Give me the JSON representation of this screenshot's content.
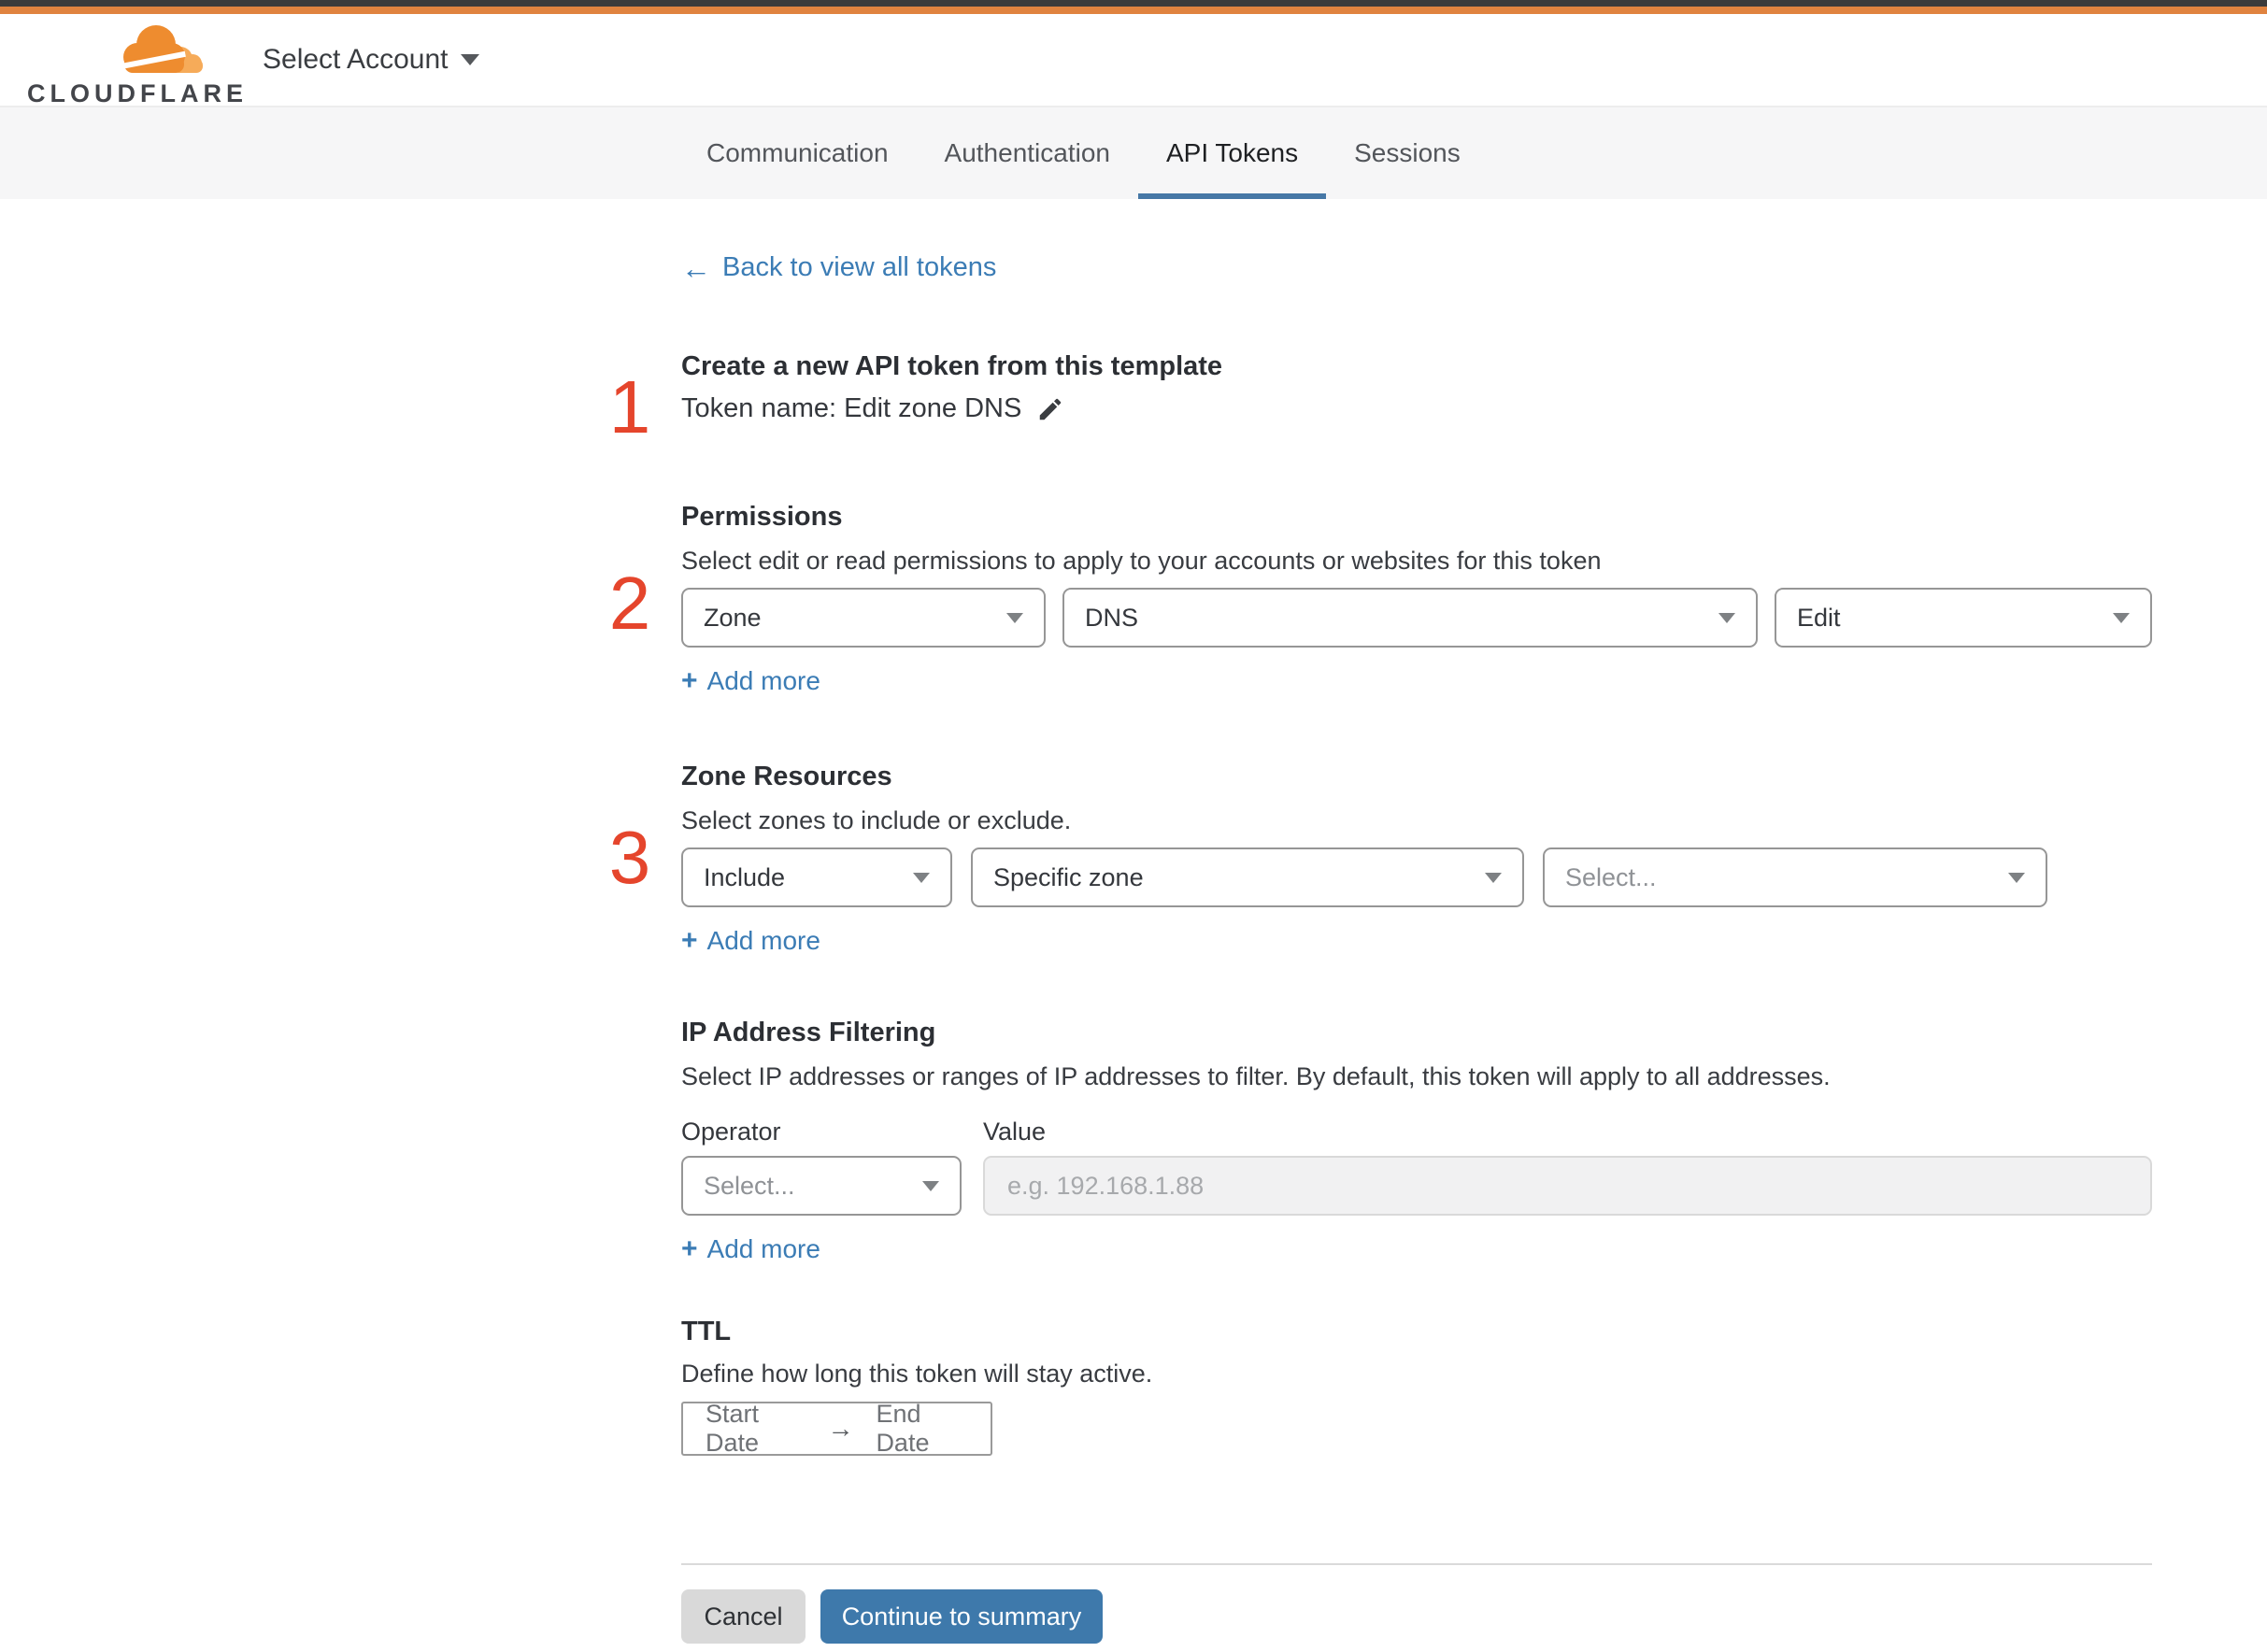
{
  "colors": {
    "topbar_dark": "#3b3b3b",
    "topbar_orange": "#e0833f",
    "brand_orange": "#ee8c2f",
    "brand_orange_light": "#f6ab59",
    "link_blue": "#3b7cb5",
    "button_blue": "#3e79ab",
    "tab_underline": "#4678a6",
    "annotation_red": "#e5452c"
  },
  "header": {
    "logo_text": "CLOUDFLARE",
    "account_selector": "Select Account"
  },
  "tabs": [
    {
      "label": "Communication",
      "active": false
    },
    {
      "label": "Authentication",
      "active": false
    },
    {
      "label": "API Tokens",
      "active": true
    },
    {
      "label": "Sessions",
      "active": false
    }
  ],
  "icons": {
    "arrow_left": "←",
    "arrow_right": "→",
    "plus": "+"
  },
  "back_link": {
    "label": "Back to view all tokens"
  },
  "annotations": {
    "step1": "1",
    "step2": "2",
    "step3": "3"
  },
  "create_section": {
    "title": "Create a new API token from this template",
    "token_name": "Token name: Edit zone DNS"
  },
  "permissions": {
    "title": "Permissions",
    "description": "Select edit or read permissions to apply to your accounts or websites for this token",
    "scope": "Zone",
    "service": "DNS",
    "access": "Edit",
    "add_more": "Add more"
  },
  "zone_resources": {
    "title": "Zone Resources",
    "description": "Select zones to include or exclude.",
    "mode": "Include",
    "type": "Specific zone",
    "zone_placeholder": "Select...",
    "add_more": "Add more"
  },
  "ip_filtering": {
    "title": "IP Address Filtering",
    "description": "Select IP addresses or ranges of IP addresses to filter. By default, this token will apply to all addresses.",
    "operator_label": "Operator",
    "value_label": "Value",
    "operator_placeholder": "Select...",
    "value_placeholder": "e.g. 192.168.1.88",
    "add_more": "Add more"
  },
  "ttl": {
    "title": "TTL",
    "description": "Define how long this token will stay active.",
    "start_date": "Start Date",
    "end_date": "End Date"
  },
  "footer": {
    "cancel": "Cancel",
    "continue": "Continue to summary"
  }
}
